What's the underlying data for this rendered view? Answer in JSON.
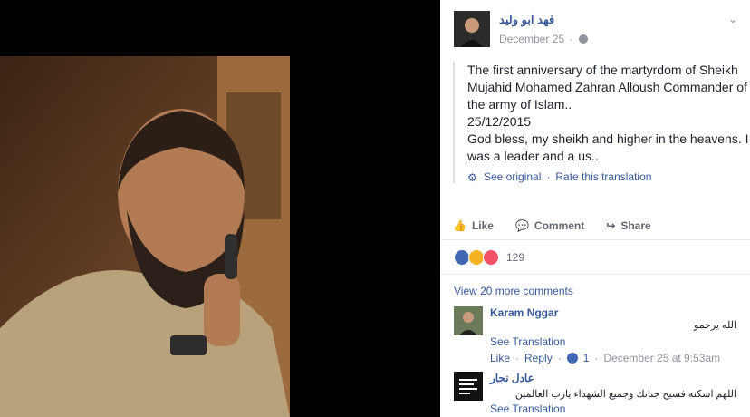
{
  "post": {
    "author": "فهد ابو وليد",
    "date": "December 25",
    "text": "The first anniversary of the martyrdom of Sheikh Mujahid Mohamed Zahran Alloush Commander of the army of Islam..\n25/12/2015\nGod bless, my sheikh and higher in the heavens. I was a leader and a us..",
    "see_original": "See original",
    "rate_translation": "Rate this translation"
  },
  "actions": {
    "like": "Like",
    "comment": "Comment",
    "share": "Share"
  },
  "reactions": {
    "count": "129"
  },
  "comments": {
    "view_more": "View 20 more comments",
    "items": [
      {
        "name": "Karam Nggar",
        "text": "الله يرحمو",
        "see_translation": "See Translation",
        "like": "Like",
        "reply": "Reply",
        "likes": "1",
        "time": "December 25 at 9:53am"
      },
      {
        "name": "عادل نجار",
        "text": "اللهم اسكنه فسيح جنانك وجميع الشهداء يارب العالمين",
        "see_translation": "See Translation"
      }
    ]
  }
}
